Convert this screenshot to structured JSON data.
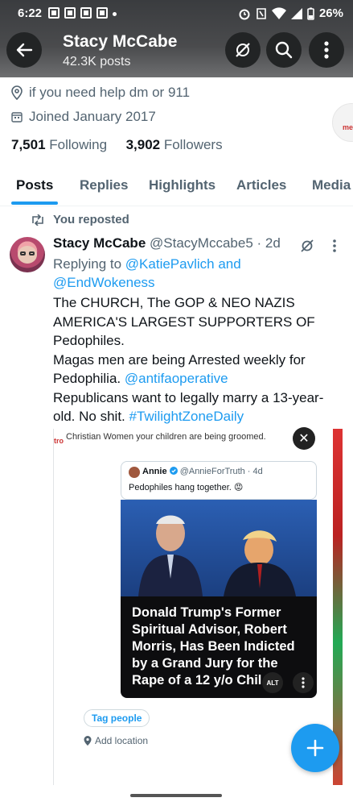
{
  "status_bar": {
    "time": "6:22",
    "battery": "26%"
  },
  "header": {
    "name": "Stacy McCabe",
    "posts_count": "42.3K posts",
    "colors": {
      "bg": "#3f4143",
      "button": "#222425"
    }
  },
  "profile": {
    "location": "if you need help dm or 911",
    "joined": "Joined January 2017",
    "following_count": "7,501",
    "following_label": "Following",
    "followers_count": "3,902",
    "followers_label": "Followers",
    "side_badge": "me"
  },
  "tabs": [
    {
      "label": "Posts",
      "active": true
    },
    {
      "label": "Replies",
      "active": false
    },
    {
      "label": "Highlights",
      "active": false
    },
    {
      "label": "Articles",
      "active": false
    },
    {
      "label": "Media",
      "active": false
    }
  ],
  "tweet": {
    "repost_label": "You reposted",
    "author_name": "Stacy McCabe",
    "author_handle": "@StacyMccabe5",
    "time": "· 2d",
    "replying_to_label": "Replying to",
    "replying_to_1": "@KatiePavlich",
    "replying_and": "and",
    "replying_to_2": "@EndWokeness",
    "text_1": "The CHURCH, The GOP & NEO NAZIS AMERICA'S LARGEST SUPPORTERS OF Pedophiles.",
    "text_2": "Magas men are being Arrested weekly for Pedophilia.",
    "mention": "@antifaoperative",
    "text_3": "Republicans want to legally marry a 13-year-old. No shit.",
    "hashtag": "#TwilightZoneDaily"
  },
  "media": {
    "quote_text": "Christian Women your children are being groomed.",
    "inner_name": "Annie",
    "inner_handle": "@AnnieForTruth · 4d",
    "inner_text": "Pedophiles hang together. 😡",
    "headline": "Donald Trump's Former Spiritual Advisor, Robert Morris, Has Been Indicted by a Grand Jury for the Rape of a 12 y/o Chil",
    "alt_label": "ALT",
    "tag_people": "Tag people",
    "add_location": "Add location",
    "left_edge_text": "tro"
  },
  "colors": {
    "accent": "#1d9bf0",
    "text": "#0f1419",
    "muted": "#536471"
  }
}
